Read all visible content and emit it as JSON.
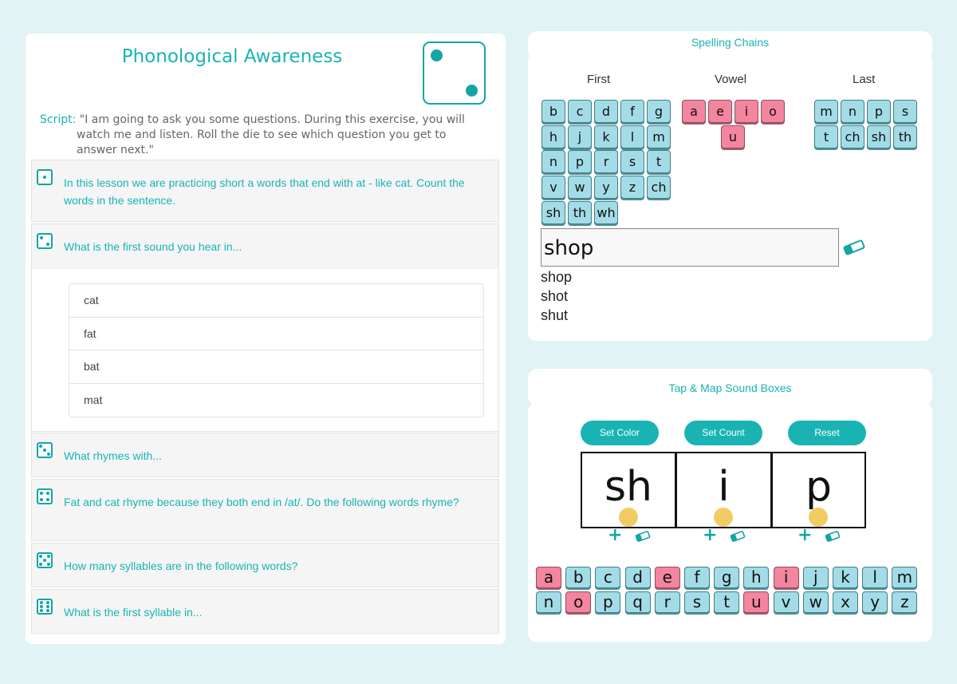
{
  "colors": {
    "accent": "#1ab3b3",
    "tile": "#a3dce6",
    "vowel_tile": "#f3859e",
    "sound_dot": "#f2cc63",
    "background": "#e2f3f6"
  },
  "left": {
    "title": "Phonological Awareness",
    "die_value": 2,
    "script_label": "Script:",
    "script_text": "\"I am going to ask you some questions. During this exercise, you will watch me and listen. Roll the die to see which question you get to answer next.\"",
    "questions": [
      {
        "die": 1,
        "icon": "die-one-icon",
        "text": "In this lesson we are practicing short a words that end with at - like cat. Count the words in the sentence."
      },
      {
        "die": 2,
        "icon": "die-two-icon",
        "text": "What is the first sound you hear in..."
      },
      {
        "die": 3,
        "icon": "die-three-icon",
        "text": "What rhymes with..."
      },
      {
        "die": 4,
        "icon": "die-four-icon",
        "text": "Fat and cat rhyme because they both end in /at/. Do the following words rhyme?"
      },
      {
        "die": 5,
        "icon": "die-five-icon",
        "text": "How many syllables are in the following words?"
      },
      {
        "die": 6,
        "icon": "die-six-icon",
        "text": "What is the first syllable in..."
      }
    ],
    "expanded_words": [
      "cat",
      "fat",
      "bat",
      "mat"
    ]
  },
  "spelling": {
    "title": "Spelling Chains",
    "first_label": "First",
    "vowel_label": "Vowel",
    "last_label": "Last",
    "first_tiles": [
      "b",
      "c",
      "d",
      "f",
      "g",
      "h",
      "j",
      "k",
      "l",
      "m",
      "n",
      "p",
      "r",
      "s",
      "t",
      "v",
      "w",
      "y",
      "z",
      "ch",
      "sh",
      "th",
      "wh"
    ],
    "vowel_tiles": [
      "a",
      "e",
      "i",
      "o",
      "u"
    ],
    "last_tiles": [
      "m",
      "n",
      "p",
      "s",
      "t",
      "ch",
      "sh",
      "th"
    ],
    "current_word": "shop",
    "eraser_icon": "eraser-icon",
    "chain": [
      "shop",
      "shot",
      "shut"
    ]
  },
  "tapmap": {
    "title": "Tap & Map Sound Boxes",
    "set_color": "Set Color",
    "set_count": "Set Count",
    "reset": "Reset",
    "boxes": [
      "sh",
      "i",
      "p"
    ],
    "plus_symbol": "+",
    "alphabet_row1": [
      "a",
      "b",
      "c",
      "d",
      "e",
      "f",
      "g",
      "h",
      "i",
      "j",
      "k",
      "l",
      "m"
    ],
    "alphabet_row2": [
      "n",
      "o",
      "p",
      "q",
      "r",
      "s",
      "t",
      "u",
      "v",
      "w",
      "x",
      "y",
      "z"
    ],
    "vowels": [
      "a",
      "e",
      "i",
      "o",
      "u"
    ]
  }
}
